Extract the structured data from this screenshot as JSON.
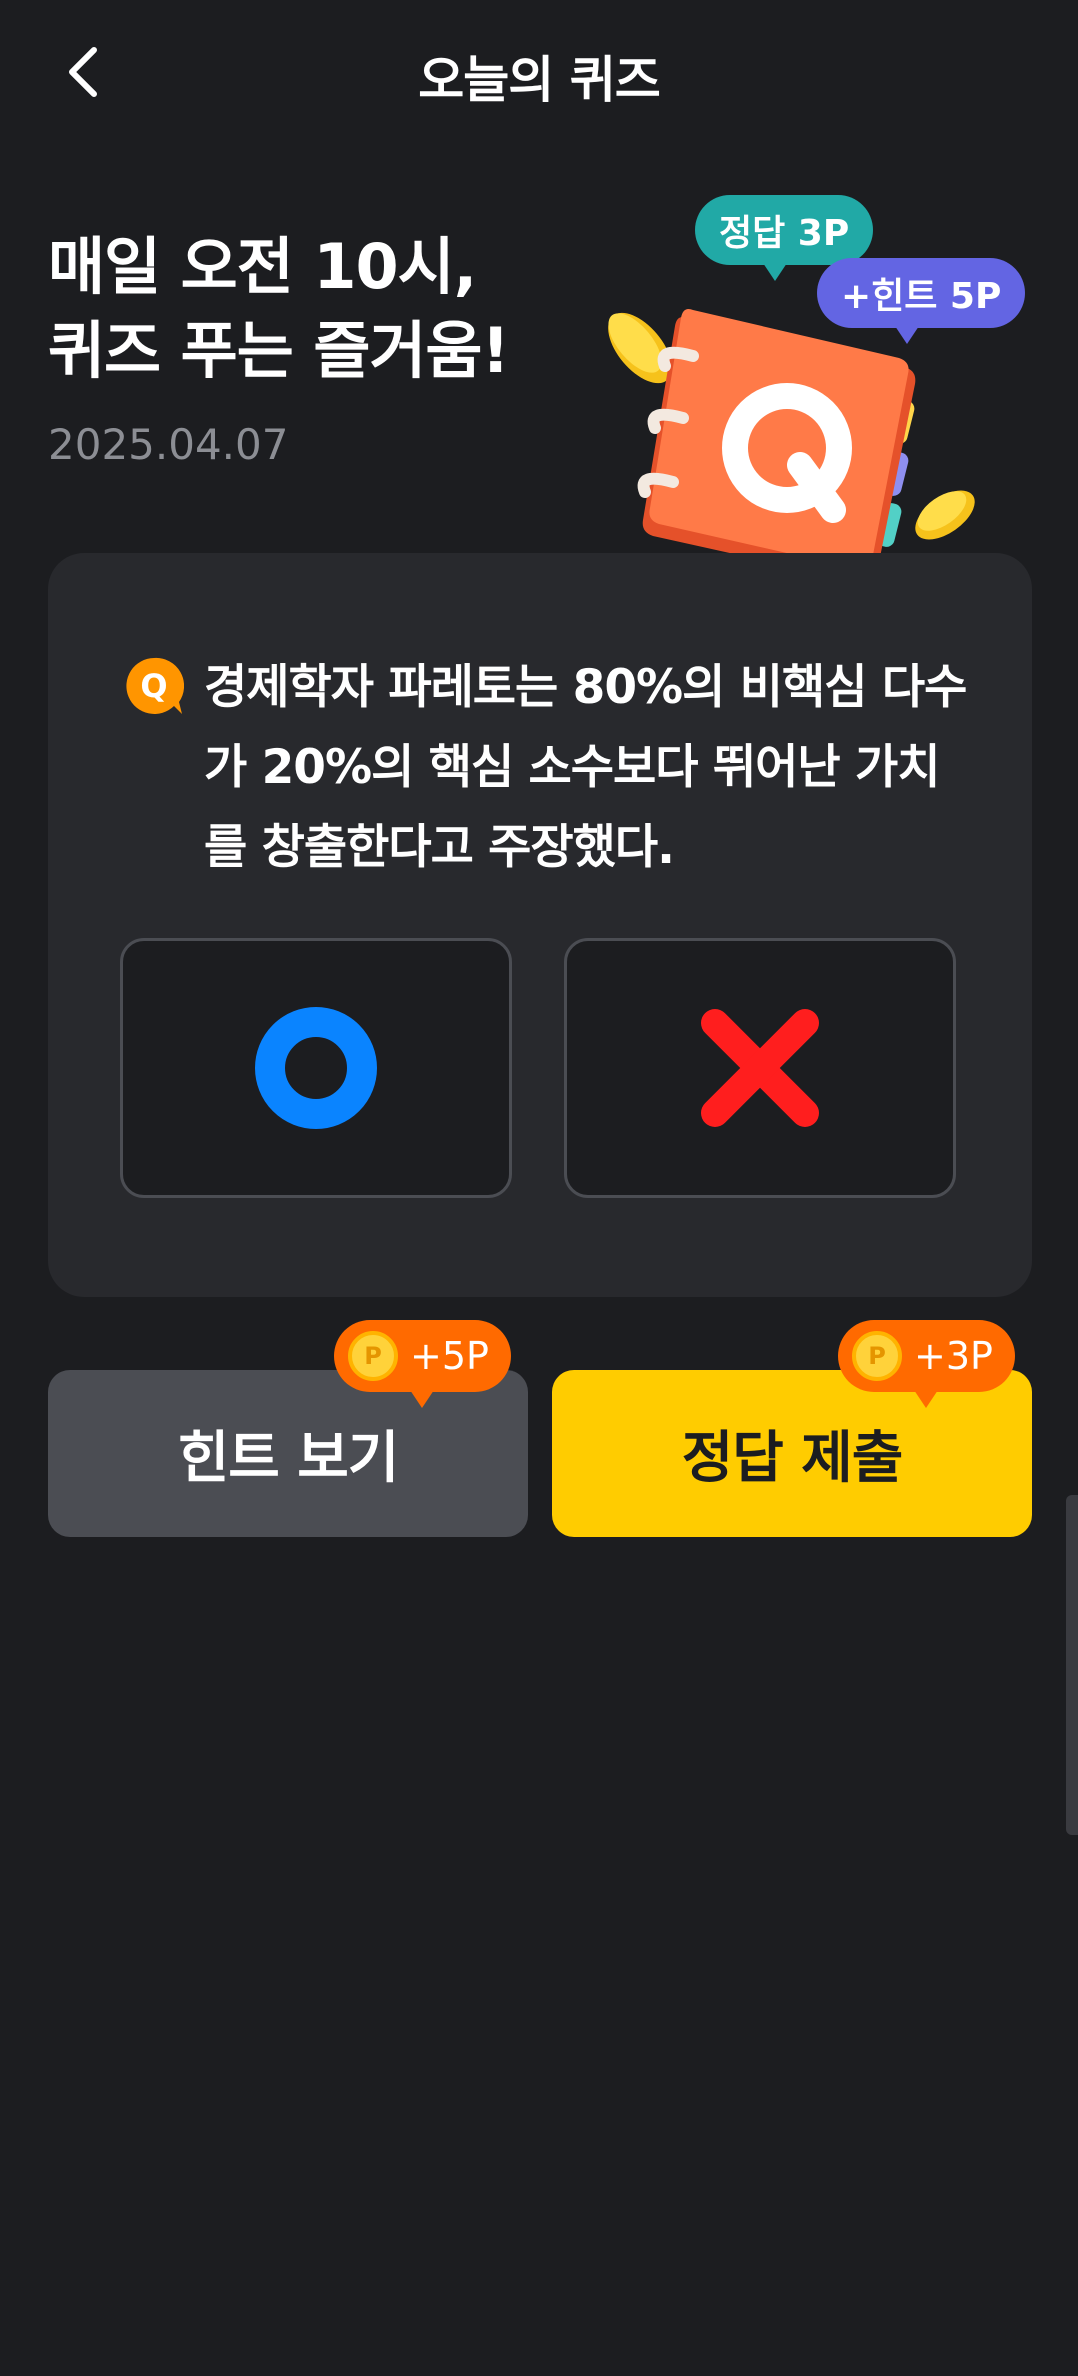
{
  "header": {
    "title": "오늘의 퀴즈"
  },
  "hero": {
    "title_line1": "매일 오전 10시,",
    "title_line2": "퀴즈 푸는 즐거움!",
    "date": "2025.04.07",
    "bubble_answer": "정답 3P",
    "bubble_hint": "+힌트 5P",
    "illustration_letter": "Q"
  },
  "quiz": {
    "badge": "Q",
    "question_line1": "경제학자 파레토는 80%의 비핵심 다수",
    "question_line2": "가 20%의 핵심 소수보다 뛰어난 가치",
    "question_line3": "를 창출한다고 주장했다.",
    "options": [
      "O",
      "X"
    ]
  },
  "actions": {
    "hint_label": "힌트 보기",
    "hint_reward": "+5P",
    "submit_label": "정답 제출",
    "submit_reward": "+3P",
    "coin_symbol": "P"
  },
  "colors": {
    "background": "#1c1d20",
    "card": "#28292d",
    "accent_yellow": "#ffcc00",
    "reward_orange": "#ff6a00",
    "option_o_blue": "#0a84ff",
    "option_x_red": "#ff1e1e",
    "bubble_teal": "#21a9a6",
    "bubble_purple": "#6365e3"
  }
}
